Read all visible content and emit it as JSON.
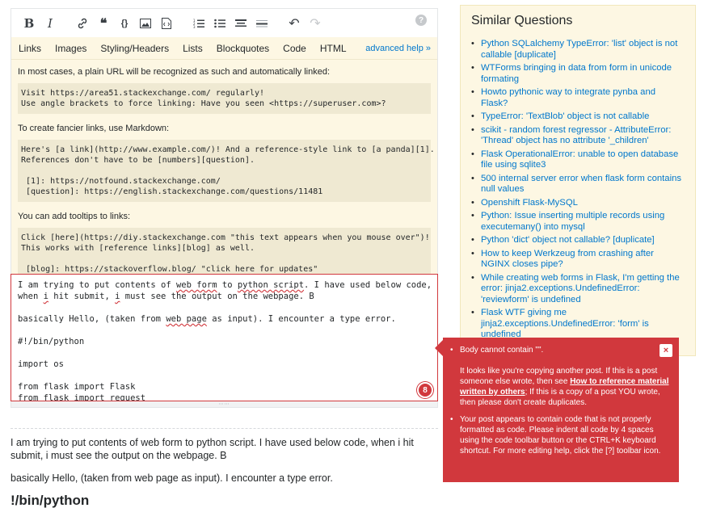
{
  "toolbar": {
    "buttons": [
      {
        "name": "bold-button",
        "icon": "B"
      },
      {
        "name": "italic-button",
        "icon": "I"
      },
      {
        "name": "link-button",
        "icon": "⚭"
      },
      {
        "name": "blockquote-button",
        "icon": "❝"
      },
      {
        "name": "code-button",
        "icon": "{}"
      },
      {
        "name": "image-button",
        "icon": "▣"
      },
      {
        "name": "snippet-button",
        "icon": "⧉"
      },
      {
        "name": "numbered-list-button",
        "icon": "☷"
      },
      {
        "name": "bulleted-list-button",
        "icon": "☰"
      },
      {
        "name": "heading-button",
        "icon": "≡"
      },
      {
        "name": "hr-button",
        "icon": "⎯"
      },
      {
        "name": "undo-button",
        "icon": "↶"
      },
      {
        "name": "redo-button",
        "icon": "↷"
      }
    ],
    "help_icon": "?"
  },
  "help": {
    "tabs": [
      "Links",
      "Images",
      "Styling/Headers",
      "Lists",
      "Blockquotes",
      "Code",
      "HTML"
    ],
    "advanced": "advanced help »",
    "p1": "In most cases, a plain URL will be recognized as such and automatically linked:",
    "code1": "Visit https://area51.stackexchange.com/ regularly!\nUse angle brackets to force linking: Have you seen <https://superuser.com>?",
    "p2": "To create fancier links, use Markdown:",
    "code2": "Here's [a link](http://www.example.com/)! And a reference-style link to [a panda][1].\nReferences don't have to be [numbers][question].\n\n [1]: https://notfound.stackexchange.com/\n [question]: https://english.stackexchange.com/questions/11481",
    "p3": "You can add tooltips to links:",
    "code3": "Click [here](https://diy.stackexchange.com \"this text appears when you mouse over\")!\nThis works with [reference links][blog] as well.\n\n [blog]: https://stackoverflow.blog/ \"click here for updates\""
  },
  "editor": {
    "l1a": "I am trying to put contents of ",
    "l1b": "web form",
    "l1c": " to ",
    "l1d": "python script",
    "l1e": ". I have used below code,",
    "l2a": "when ",
    "l2b": "i",
    "l2c": " hit submit, ",
    "l2d": "i",
    "l2e": " must see the output on the webpage. B",
    "l3a": "basically Hello, (taken from ",
    "l3b": "web page",
    "l3c": " as input). I encounter a type error.",
    "l4": "#!/bin/python",
    "l5": "import os",
    "l6": "from flask import Flask",
    "l7": "from flask import request",
    "error_count": "8",
    "grip": "⋯⋯"
  },
  "preview": {
    "p1": "I am trying to put contents of web form to python script. I have used below code, when i hit submit, i must see the output on the webpage. B",
    "p2": "basically Hello, (taken from web page as input). I encounter a type error.",
    "h1": "!/bin/python"
  },
  "similar": {
    "title": "Similar Questions",
    "items": [
      "Python SQLalchemy TypeError: 'list' object is not callable [duplicate]",
      "WTForms bringing in data from form in unicode formating",
      "Howto pythonic way to integrate pynba and Flask?",
      "TypeError: 'TextBlob' object is not callable",
      "scikit - random forest regressor - AttributeError: 'Thread' object has no attribute '_children'",
      "Flask OperationalError: unable to open database file using sqlite3",
      "500 internal server error when flask form contains null values",
      "Openshift Flask-MySQL",
      "Python: Issue inserting multiple records using executemany() into mysql",
      "Python 'dict' object not callable? [duplicate]",
      "How to keep Werkzeug from crashing after NGINX closes pipe?",
      "While creating web forms in Flask, I'm getting the error: jinja2.exceptions.UndefinedError: 'reviewform' is undefined",
      "Flask WTF giving me jinja2.exceptions.UndefinedError: 'form' is undefined"
    ]
  },
  "popup": {
    "close": "×",
    "e1_title": "Body cannot contain \"\".",
    "e1_a": "It looks like you're copying another post. If this is a post someone else wrote, then see ",
    "e1_link": "How to reference material written by others",
    "e1_b": "; If this is a copy of a post YOU wrote, then please don't create duplicates.",
    "e2": "Your post appears to contain code that is not properly formatted as code. Please indent all code by 4 spaces using the code toolbar button or the CTRL+K keyboard shortcut. For more editing help, click the [?] toolbar icon."
  }
}
